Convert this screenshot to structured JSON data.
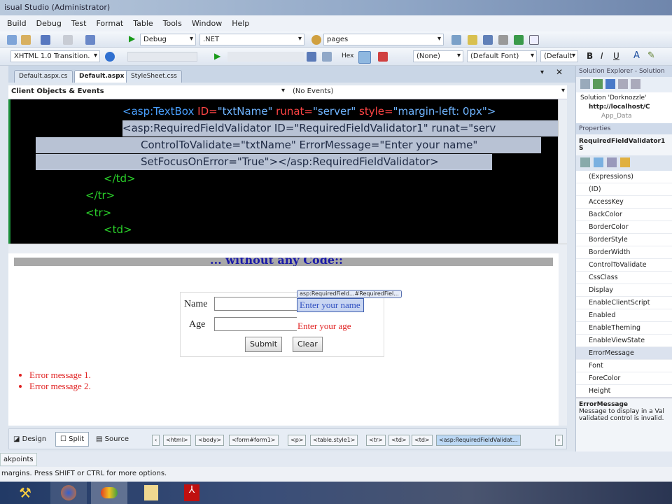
{
  "window": {
    "title": "isual Studio (Administrator)"
  },
  "menu": [
    "Build",
    "Debug",
    "Test",
    "Format",
    "Table",
    "Tools",
    "Window",
    "Help"
  ],
  "toolbar1": {
    "config": "Debug",
    "platform": ".NET",
    "find": "pages"
  },
  "toolbar2": {
    "doctype": "XHTML 1.0 Transition.",
    "hex_label": "Hex",
    "style": "(None)",
    "font": "(Default Font)",
    "size": "(Default"
  },
  "tabs": [
    {
      "label": "Default.aspx.cs"
    },
    {
      "label": "Default.aspx"
    },
    {
      "label": "StyleSheet.css"
    }
  ],
  "objbar": {
    "objects": "Client Objects & Events",
    "events": "(No Events)"
  },
  "code": [
    [
      "<asp:TextBox ",
      "ID=",
      "\"txtName\" ",
      "runat=",
      "\"server\" ",
      "style=",
      "\"margin-left: 0px\">"
    ],
    [
      "<asp:RequiredFieldValidator ID=\"RequiredFieldValidator1\" runat=\"serv"
    ],
    [
      "ControlToValidate=\"txtName\" ErrorMessage=\"Enter your name\""
    ],
    [
      "SetFocusOnError=\"True\"></asp:RequiredFieldValidator>"
    ],
    [
      "</td>"
    ],
    [
      "</tr>"
    ],
    [
      "<tr>"
    ],
    [
      "<td>"
    ]
  ],
  "design": {
    "heading": "... without any Code::",
    "name_label": "Name",
    "age_label": "Age",
    "validator_tag": "asp:RequiredField...#RequiredFiel...",
    "name_error": "Enter your name",
    "age_error": "Enter your age",
    "submit": "Submit",
    "clear": "Clear",
    "errors": [
      "Error message 1.",
      "Error message 2."
    ]
  },
  "views": {
    "design": "Design",
    "split": "Split",
    "source": "Source"
  },
  "crumbs": [
    "<html>",
    "<body>",
    "<form#form1>",
    "<p>",
    "<table.style1>",
    "<tr>",
    "<td>",
    "<td>",
    "<asp:RequiredFieldValidat..."
  ],
  "solution": {
    "header": "Solution Explorer - Solution",
    "items": [
      "Solution 'Dorknozzle'",
      "http://localhost/C",
      "App_Data"
    ]
  },
  "properties": {
    "header": "Properties",
    "object": "RequiredFieldValidator1 S",
    "items": [
      "(Expressions)",
      "(ID)",
      "AccessKey",
      "BackColor",
      "BorderColor",
      "BorderStyle",
      "BorderWidth",
      "ControlToValidate",
      "CssClass",
      "Display",
      "EnableClientScript",
      "Enabled",
      "EnableTheming",
      "EnableViewState",
      "ErrorMessage",
      "Font",
      "ForeColor",
      "Height"
    ],
    "selected": "ErrorMessage",
    "desc_title": "ErrorMessage",
    "desc": "Message to display in a Val validated control is invalid."
  },
  "breakpoints_tab": "akpoints",
  "status": "margins. Press SHIFT or CTRL for more options."
}
